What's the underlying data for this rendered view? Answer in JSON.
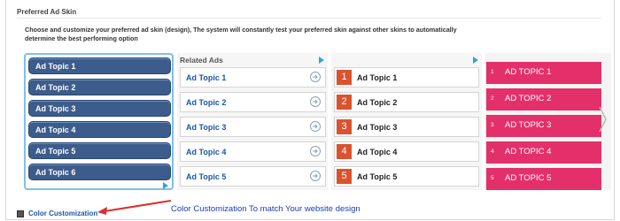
{
  "section": {
    "title": "Preferred Ad Skin",
    "description": "Choose and customize your preferred ad skin (design), The system will constantly test your preferred skin against other skins to automatically determine the best performing option"
  },
  "skin_blue": {
    "items": [
      "Ad Topic 1",
      "Ad Topic 2",
      "Ad Topic 3",
      "Ad Topic 4",
      "Ad Topic 5",
      "Ad Topic 6"
    ],
    "accent": "#3c5c8c",
    "selected_border": "#7fc0ea"
  },
  "skin_related": {
    "header": "Related Ads",
    "items": [
      "Ad Topic 1",
      "Ad Topic 2",
      "Ad Topic 3",
      "Ad Topic 4",
      "Ad Topic 5"
    ],
    "link_color": "#1a57a8"
  },
  "skin_numbered": {
    "numbers": [
      "1",
      "2",
      "3",
      "4",
      "5"
    ],
    "items": [
      "Ad Topic 1",
      "Ad Topic 2",
      "Ad Topic 3",
      "Ad Topic 4",
      "Ad Topic 5"
    ],
    "accent": "#d9532e"
  },
  "skin_pink": {
    "numbers": [
      "1",
      "2",
      "3",
      "4",
      "5"
    ],
    "items": [
      "AD TOPIC 1",
      "AD TOPIC 2",
      "AD TOPIC 3",
      "AD TOPIC 4",
      "AD TOPIC 5"
    ],
    "accent": "#e4306a"
  },
  "footer": {
    "link_label": "Color Customization",
    "annotation": "Color Customization To match Your website design",
    "annotation_arrow_color": "#d9302f"
  },
  "icons": {
    "adchoices": "adchoices-icon",
    "arrow_circle": "arrow-circle-icon",
    "next": "chevron-right-icon",
    "palette": "color-palette-icon"
  }
}
